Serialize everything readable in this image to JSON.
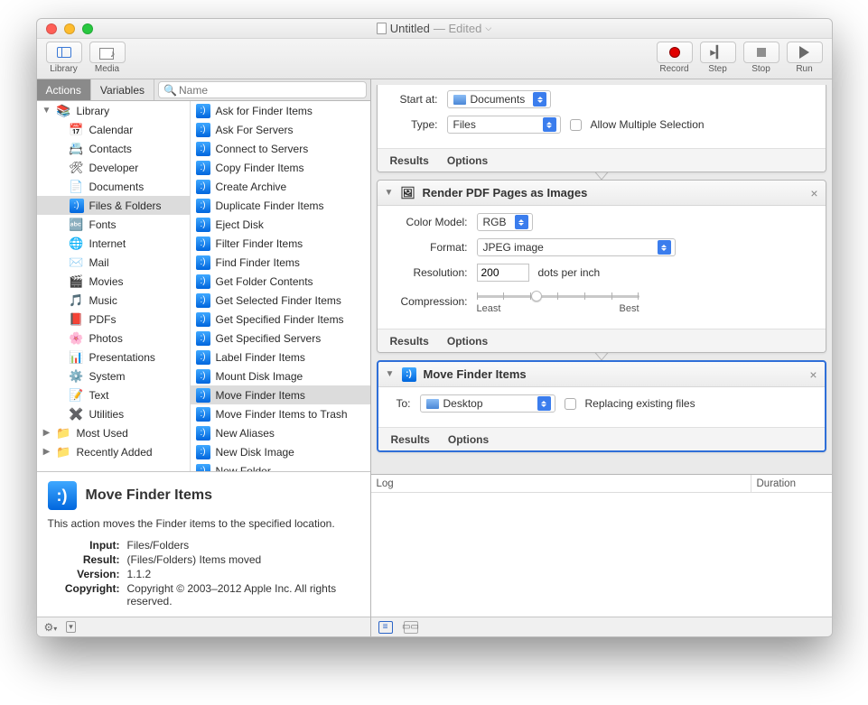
{
  "window": {
    "title": "Untitled",
    "edited": "— Edited"
  },
  "toolbar": {
    "library": "Library",
    "media": "Media",
    "record": "Record",
    "step": "Step",
    "stop": "Stop",
    "run": "Run"
  },
  "tabs": {
    "actions": "Actions",
    "variables": "Variables",
    "search_placeholder": "Name"
  },
  "categories": [
    {
      "label": "Library",
      "icon": "library",
      "disclosure": "▼",
      "indent": 0
    },
    {
      "label": "Calendar",
      "icon": "calendar",
      "indent": 1
    },
    {
      "label": "Contacts",
      "icon": "contacts",
      "indent": 1
    },
    {
      "label": "Developer",
      "icon": "developer",
      "indent": 1
    },
    {
      "label": "Documents",
      "icon": "documents",
      "indent": 1
    },
    {
      "label": "Files & Folders",
      "icon": "finder",
      "indent": 1,
      "selected": true
    },
    {
      "label": "Fonts",
      "icon": "fonts",
      "indent": 1
    },
    {
      "label": "Internet",
      "icon": "internet",
      "indent": 1
    },
    {
      "label": "Mail",
      "icon": "mail",
      "indent": 1
    },
    {
      "label": "Movies",
      "icon": "movies",
      "indent": 1
    },
    {
      "label": "Music",
      "icon": "music",
      "indent": 1
    },
    {
      "label": "PDFs",
      "icon": "pdf",
      "indent": 1
    },
    {
      "label": "Photos",
      "icon": "photos",
      "indent": 1
    },
    {
      "label": "Presentations",
      "icon": "presentations",
      "indent": 1
    },
    {
      "label": "System",
      "icon": "system",
      "indent": 1
    },
    {
      "label": "Text",
      "icon": "text",
      "indent": 1
    },
    {
      "label": "Utilities",
      "icon": "utilities",
      "indent": 1
    },
    {
      "label": "Most Used",
      "icon": "folder-purple",
      "disclosure": "▶",
      "indent": 0
    },
    {
      "label": "Recently Added",
      "icon": "folder-purple",
      "disclosure": "▶",
      "indent": 0
    }
  ],
  "actions": [
    "Ask for Finder Items",
    "Ask For Servers",
    "Connect to Servers",
    "Copy Finder Items",
    "Create Archive",
    "Duplicate Finder Items",
    "Eject Disk",
    "Filter Finder Items",
    "Find Finder Items",
    "Get Folder Contents",
    "Get Selected Finder Items",
    "Get Specified Finder Items",
    "Get Specified Servers",
    "Label Finder Items",
    "Mount Disk Image",
    "Move Finder Items",
    "Move Finder Items to Trash",
    "New Aliases",
    "New Disk Image",
    "New Folder"
  ],
  "actions_selected_index": 15,
  "detail": {
    "title": "Move Finder Items",
    "desc": "This action moves the Finder items to the specified location.",
    "keys": {
      "input": "Input:",
      "result": "Result:",
      "version": "Version:",
      "copyright": "Copyright:"
    },
    "vals": {
      "input": "Files/Folders",
      "result": "(Files/Folders) Items moved",
      "version": "1.1.2",
      "copyright": "Copyright © 2003–2012 Apple Inc.  All rights reserved."
    }
  },
  "workflow": {
    "action0": {
      "start_at_lbl": "Start at:",
      "start_at_val": "Documents",
      "type_lbl": "Type:",
      "type_val": "Files",
      "allow_multi": "Allow Multiple Selection",
      "results": "Results",
      "options": "Options"
    },
    "action1": {
      "title": "Render PDF Pages as Images",
      "colormodel_lbl": "Color Model:",
      "colormodel_val": "RGB",
      "format_lbl": "Format:",
      "format_val": "JPEG image",
      "resolution_lbl": "Resolution:",
      "resolution_val": "200",
      "dpi": "dots per inch",
      "compression_lbl": "Compression:",
      "least": "Least",
      "best": "Best",
      "results": "Results",
      "options": "Options"
    },
    "action2": {
      "title": "Move Finder Items",
      "to_lbl": "To:",
      "to_val": "Desktop",
      "replacing": "Replacing existing files",
      "results": "Results",
      "options": "Options"
    }
  },
  "log": {
    "log": "Log",
    "duration": "Duration"
  }
}
